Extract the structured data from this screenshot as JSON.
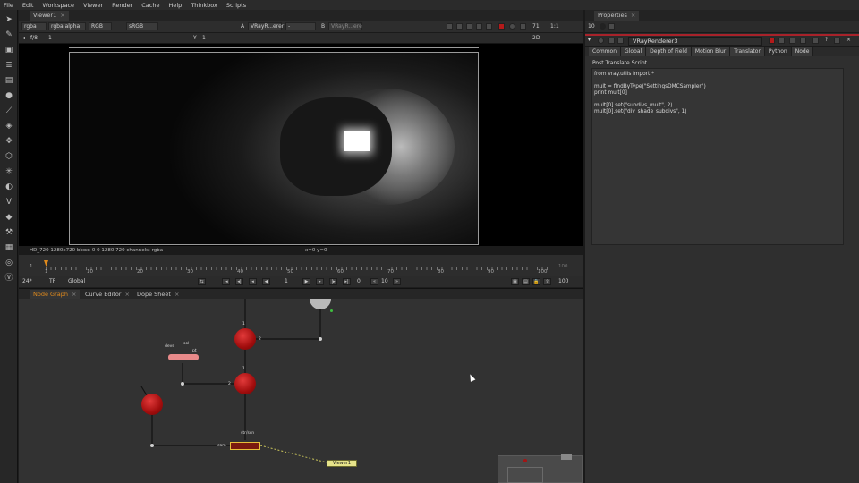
{
  "menubar": {
    "items": [
      "File",
      "Edit",
      "Workspace",
      "Viewer",
      "Render",
      "Cache",
      "Help",
      "Thinkbox",
      "Scripts"
    ]
  },
  "left_tools": [
    "pointer-icon",
    "paint-icon",
    "image-icon",
    "layers-icon",
    "channel-icon",
    "color-icon",
    "curve-icon",
    "stack-icon",
    "transform-icon",
    "3d-icon",
    "particle-icon",
    "deep-icon",
    "vray-icon",
    "tag-icon",
    "tools-icon",
    "grid-icon",
    "nuke-icon",
    "vray-logo-icon"
  ],
  "viewer": {
    "tab_label": "Viewer1",
    "channels": "rgba",
    "layer": "rgba.alpha",
    "colorspace_mode": "RGB",
    "lut": "sRGB",
    "input_a_label": "A",
    "input_a_value": "VRayR...erer",
    "input_b_label": "B",
    "input_b_value": "VRayR...ere",
    "input_dash": "-",
    "zoom": "71",
    "ratio": "1:1",
    "fstop": "f/8",
    "gain_val": "1",
    "y_label": "Y",
    "gamma_val": "1",
    "view_mode": "2D",
    "status_left": "HD_720 1280x720  bbox: 0 0 1280 720 channels: rgba",
    "status_coords": "x=0 y=0"
  },
  "timeline": {
    "start_frame": "1",
    "end_frame": "100",
    "ticks": [
      "1",
      "10",
      "20",
      "30",
      "40",
      "50",
      "60",
      "70",
      "80",
      "90",
      "100"
    ],
    "fps": "24*",
    "tf_label": "TF",
    "range_mode": "Global",
    "current_frame": "1",
    "step_frame": "10",
    "end_field": "100",
    "zero_field": "0"
  },
  "node_graph": {
    "tabs": [
      {
        "label": "Node Graph",
        "active": true
      },
      {
        "label": "Curve Editor",
        "active": false
      },
      {
        "label": "Dope Sheet",
        "active": false
      }
    ],
    "viewer_node_label": "Viewer1",
    "write_label": "cam",
    "input_label_1": "2",
    "input_label_2": "1",
    "input_label_3": "1",
    "input_label_4": "2",
    "output_label": "str/scn",
    "read_labels": [
      "devs",
      "sol",
      "pt"
    ]
  },
  "properties": {
    "tab_label": "Properties",
    "max_panels": "10",
    "node_name": "VRayRenderer3",
    "tabs": [
      {
        "label": "Common",
        "active": false
      },
      {
        "label": "Global",
        "active": false
      },
      {
        "label": "Depth of Field",
        "active": false
      },
      {
        "label": "Motion Blur",
        "active": false
      },
      {
        "label": "Translator",
        "active": false
      },
      {
        "label": "Python",
        "active": true
      },
      {
        "label": "Node",
        "active": false
      }
    ],
    "section_label": "Post Translate Script",
    "script_lines": [
      "from vray.utils import *",
      "",
      "mult = findByType(\"SettingsDMCSampler\")",
      "print mult[0]",
      "",
      "mult[0].set(\"subdivs_mult\", 2)",
      "mult[0].set(\"div_shade_subdivs\", 1)"
    ]
  },
  "colors": {
    "accent_orange": "#e08a1c",
    "node_red": "#b51212",
    "viewer_node": "#e6e38a",
    "props_red": "#a8222a"
  }
}
